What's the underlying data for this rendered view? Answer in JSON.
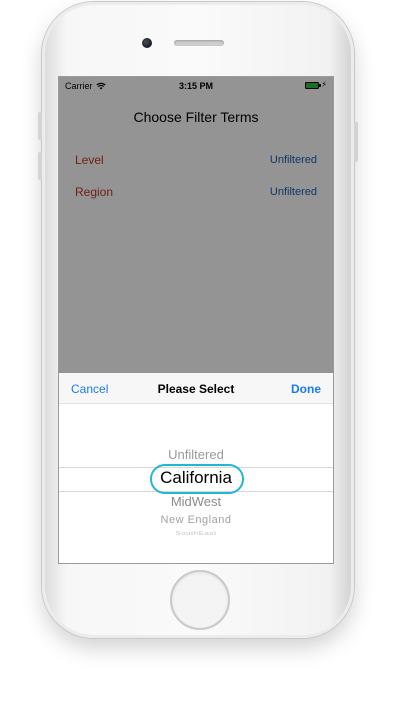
{
  "status_bar": {
    "carrier": "Carrier",
    "time": "3:15 PM",
    "wifi_icon": "wifi-icon",
    "battery_icon": "battery-icon",
    "battery_color": "#2fbf3a"
  },
  "screen": {
    "title": "Choose Filter Terms",
    "rows": [
      {
        "label": "Level",
        "value": "Unfiltered"
      },
      {
        "label": "Region",
        "value": "Unfiltered"
      }
    ],
    "label_color": "#c0392b",
    "value_color": "#1a5fb4"
  },
  "picker": {
    "cancel_label": "Cancel",
    "title": "Please Select",
    "done_label": "Done",
    "accent_color": "#1a7cf0",
    "options": [
      "Unfiltered",
      "California",
      "MidWest",
      "New England",
      "SouthEast"
    ],
    "selected": "California"
  }
}
